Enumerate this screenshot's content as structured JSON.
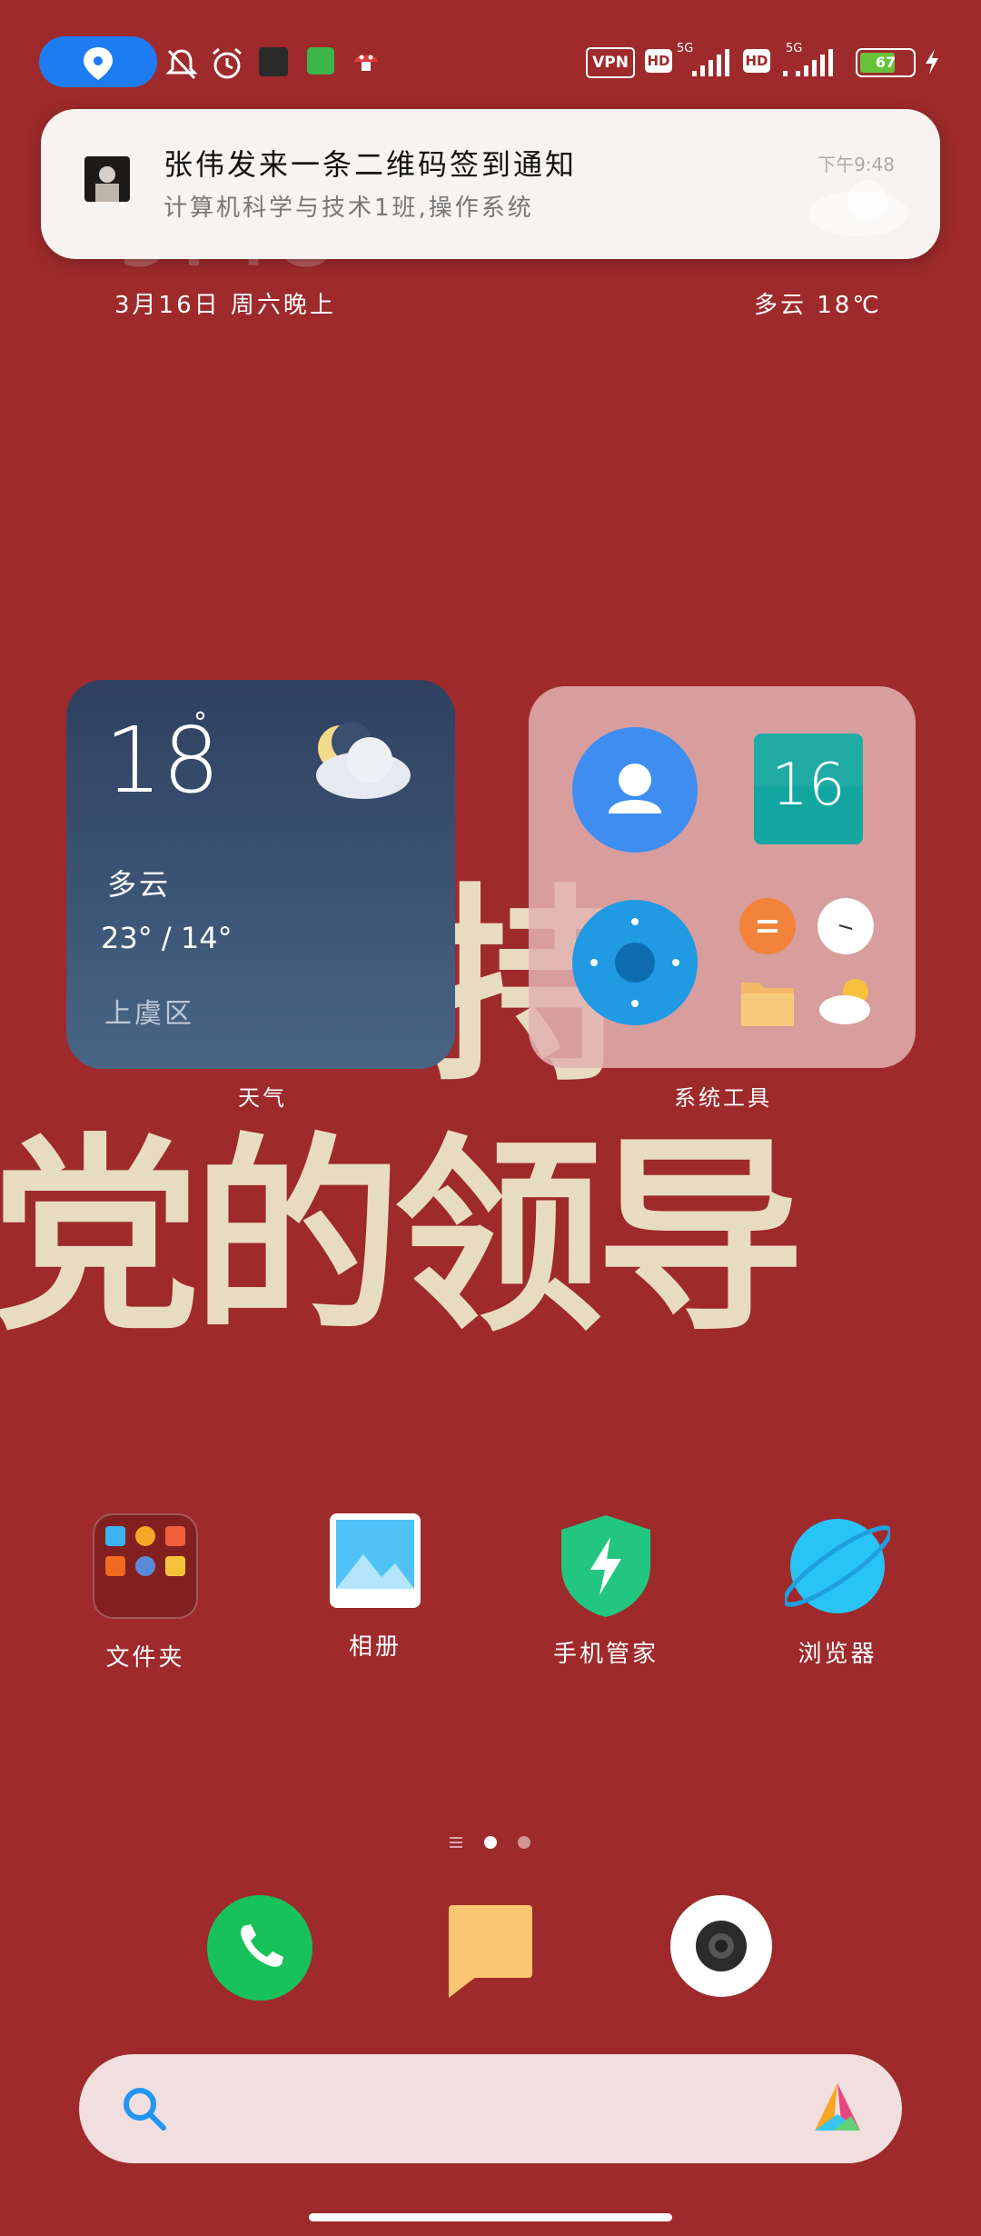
{
  "status_bar": {
    "vpn_label": "VPN",
    "hd1": "HD",
    "net1": "5G",
    "hd2": "HD",
    "net2": "5G",
    "battery": "67"
  },
  "notification": {
    "title": "张伟发来一条二维码签到通知",
    "body": "计算机科学与技术1班,操作系统",
    "time": "下午9:48"
  },
  "lockscreen": {
    "time": "9:48",
    "date": "3月16日 周六晚上",
    "weather": "多云 18℃"
  },
  "weather_widget": {
    "temp": "18",
    "degree": "°",
    "condition": "多云",
    "range": "23° / 14°",
    "location": "上虞区",
    "label": "天气"
  },
  "tools_widget": {
    "calendar_day": "16",
    "label": "系统工具"
  },
  "wallpaper": {
    "line1": "持",
    "line2": "党的领导"
  },
  "apps": [
    {
      "label": "文件夹"
    },
    {
      "label": "相册"
    },
    {
      "label": "手机管家"
    },
    {
      "label": "浏览器"
    }
  ],
  "colors": {
    "wallpaper_red": "#9e2a2b",
    "accent_blue": "#1e7cf2",
    "phone_green": "#18c25a"
  }
}
